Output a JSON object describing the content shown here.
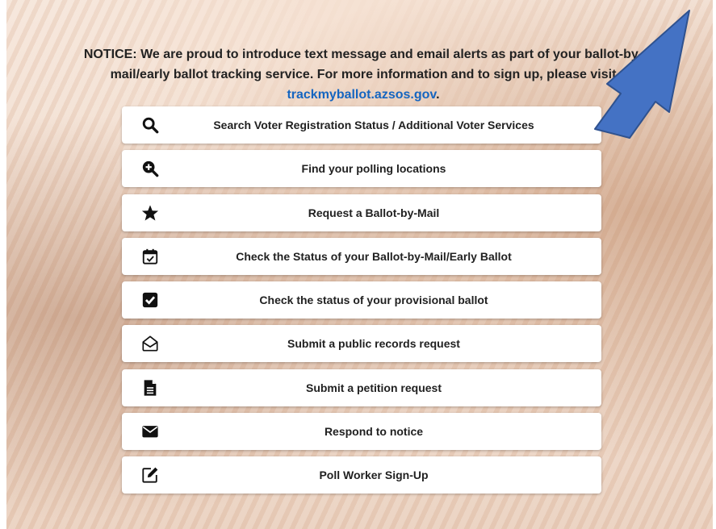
{
  "notice": {
    "text_1": "NOTICE: We are proud to introduce text message and email alerts as part of your ballot-by-",
    "text_2": "mail/early ballot tracking service. For more information and to sign up, please visit",
    "link": "trackmyballot.azsos.gov",
    "link_suffix": "."
  },
  "menu": {
    "items": [
      {
        "label": "Search Voter Registration Status / Additional Voter Services",
        "icon": "search-icon"
      },
      {
        "label": "Find your polling locations",
        "icon": "zoom-in-icon"
      },
      {
        "label": "Request a Ballot-by-Mail",
        "icon": "star-icon"
      },
      {
        "label": "Check the Status of your Ballot-by-Mail/Early Ballot",
        "icon": "calendar-check-icon"
      },
      {
        "label": "Check the status of your provisional ballot",
        "icon": "checkbox-icon"
      },
      {
        "label": "Submit a public records request",
        "icon": "envelope-open-icon"
      },
      {
        "label": "Submit a petition request",
        "icon": "document-icon"
      },
      {
        "label": "Respond to notice",
        "icon": "envelope-icon"
      },
      {
        "label": "Poll Worker Sign-Up",
        "icon": "edit-icon"
      }
    ]
  },
  "colors": {
    "link": "#1565c0",
    "arrow_fill": "#4472c4",
    "arrow_stroke": "#2f528f",
    "icon": "#111111"
  }
}
